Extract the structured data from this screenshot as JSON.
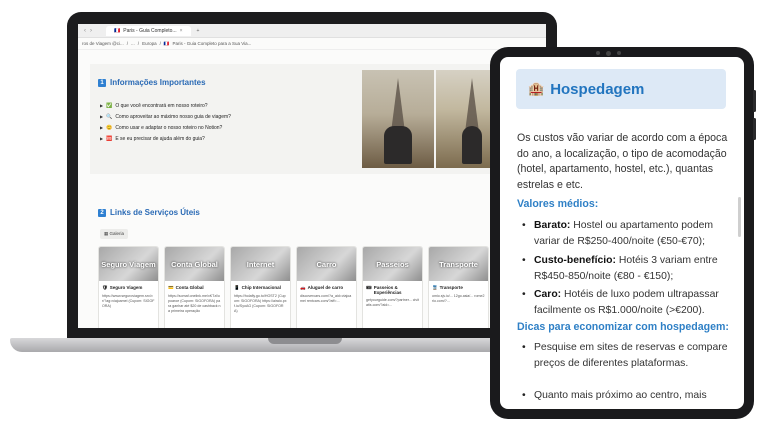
{
  "browser": {
    "tab_title": "Paris - Guia Completo...",
    "tab_flag": "🇫🇷",
    "new_tab": "+"
  },
  "breadcrumbs": [
    "ros de Viagem @ci...",
    "/",
    "...",
    "/",
    "Europa",
    "/",
    "Paris - Guia Completo para a Sua Via..."
  ],
  "section1": {
    "number": "1",
    "title": "Informações Importantes",
    "items": [
      {
        "icon": "✅",
        "text": "O que você encontrará em nosso roteiro?"
      },
      {
        "icon": "🔍",
        "text": "Como aproveitar ao máximo nosso guia de viagem?"
      },
      {
        "icon": "😊",
        "text": "Como usar e adaptar o nosso roteiro no Notion?"
      },
      {
        "icon": "🆘",
        "text": "E se eu precisar de ajuda além do guia?"
      }
    ]
  },
  "section2": {
    "number": "2",
    "title": "Links de Serviços Úteis",
    "view_label": "Galeria",
    "cards": [
      {
        "cover": "Seguro Viagem",
        "icon": "🛡",
        "title": "Seguro Viagem",
        "desc": "https://www.seguroviagem.srv.br/?ag=viajoamei (Cupom: SIGOFORA)"
      },
      {
        "cover": "Conta Global",
        "icon": "💳",
        "title": "Conta Global",
        "desc": "https://somaf.onelink.me/xKTzl/opoaroe (Cupom: SIGOFORA) para ganhar até $20 de cashback na primeira operação"
      },
      {
        "cover": "Internet",
        "icon": "📱",
        "title": "Chip Internacional",
        "desc": "https://holafly.go.to/HOST2 (Cupom: SIGOFORA) https://airalo.pxf.io/SyoAG (Cupom: SIGOFORA)"
      },
      {
        "cover": "Carro",
        "icon": "🚗",
        "title": "Aluguel de carro",
        "desc": "discovercars.com/?a_aid=viajoamei rentcars.com/?aff=..."
      },
      {
        "cover": "Passeios",
        "icon": "🎟",
        "title": "Passeios & Experiências",
        "desc": "getyourguide.com/?partner... civitatis.com/?aid=..."
      },
      {
        "cover": "Transporte",
        "icon": "🚆",
        "title": "Transporte",
        "desc": "omio.sjv.io/... 12go.asia/... rome2rio.com/?..."
      }
    ]
  },
  "tablet": {
    "header_icon": "🏨",
    "header_title": "Hospedagem",
    "intro": "Os custos vão variar de acordo com a época do ano, a localização, o tipo de acomodação (hotel, apartamento, hostel, etc.), quantas estrelas e etc.",
    "values_heading": "Valores médios:",
    "values": [
      {
        "label": "Barato:",
        "text": " Hostel ou apartamento podem variar de R$250-400/noite (€50-€70);"
      },
      {
        "label": "Custo-benefício:",
        "text": " Hotéis 3 variam entre R$450-850/noite (€80 - €150);"
      },
      {
        "label": "Caro:",
        "text": " Hotéis de luxo podem ultrapassar facilmente os R$1.000/noite (>€200)."
      }
    ],
    "tips_heading": "Dicas para economizar com hospedagem:",
    "tips": [
      "Pesquise em sites de reservas e compare preços de diferentes plataformas.",
      "Quanto mais próximo ao centro, mais"
    ]
  }
}
